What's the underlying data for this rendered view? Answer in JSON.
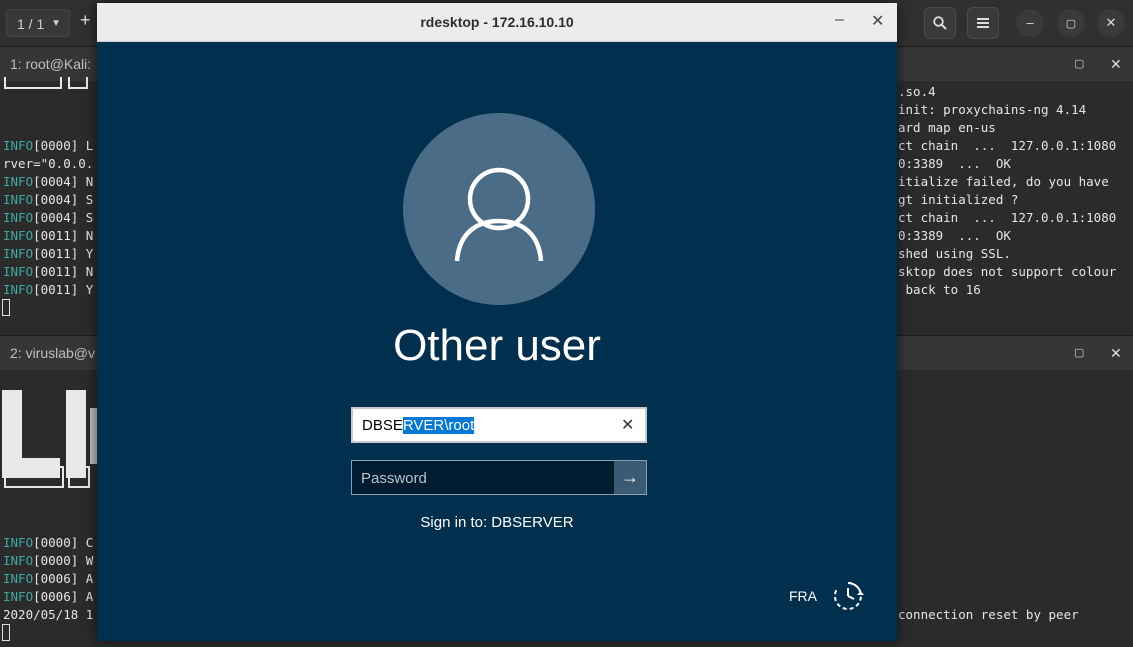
{
  "terminal": {
    "tab_counter": "1 / 1",
    "new_tab_symbol": "+",
    "header_buttons": [
      "search-icon",
      "menu-icon",
      "minimize-icon",
      "maximize-icon",
      "close-icon"
    ],
    "pane1": {
      "title": "1: root@Kali:",
      "left_lines": [
        {
          "prefix": "INFO",
          "text": "[0000] L"
        },
        {
          "prefix": "",
          "text": "rver=\"0.0.0."
        },
        {
          "prefix": "INFO",
          "text": "[0004] N"
        },
        {
          "prefix": "INFO",
          "text": "[0004] S"
        },
        {
          "prefix": "INFO",
          "text": "[0004] S"
        },
        {
          "prefix": "INFO",
          "text": "[0011] N"
        },
        {
          "prefix": "INFO",
          "text": "[0011] Y"
        },
        {
          "prefix": "INFO",
          "text": "[0011] N"
        },
        {
          "prefix": "INFO",
          "text": "[0011] Y"
        }
      ],
      "right_lines": [
        ".so.4",
        "init: proxychains-ng 4.14",
        "ard map en-us",
        "ct chain  ...  127.0.0.1:1080",
        "0:3389  ...  OK",
        "itialize failed, do you have",
        "gt initialized ?",
        "ct chain  ...  127.0.0.1:1080",
        "0:3389  ...  OK",
        "shed using SSL.",
        "sktop does not support colour",
        " back to 16"
      ]
    },
    "pane2": {
      "title": "2: viruslab@v",
      "left_lines": [
        {
          "prefix": "INFO",
          "text": "[0000] C"
        },
        {
          "prefix": "INFO",
          "text": "[0000] W"
        },
        {
          "prefix": "INFO",
          "text": "[0006] A"
        },
        {
          "prefix": "INFO",
          "text": "[0006] A"
        },
        {
          "prefix": "",
          "text": "2020/05/18 1"
        }
      ],
      "right_lines": [
        "connection reset by peer"
      ]
    }
  },
  "rdesktop": {
    "title": "rdesktop - 172.16.10.10",
    "min_symbol": "–",
    "close_symbol": "✕",
    "login": {
      "user_display": "Other user",
      "username_value_unselected": "DBSE",
      "username_value_selected": "RVER\\root",
      "clear_symbol": "✕",
      "password_placeholder": "Password",
      "submit_symbol": "→",
      "sign_in_to": "Sign in to: DBSERVER",
      "language": "FRA"
    }
  }
}
